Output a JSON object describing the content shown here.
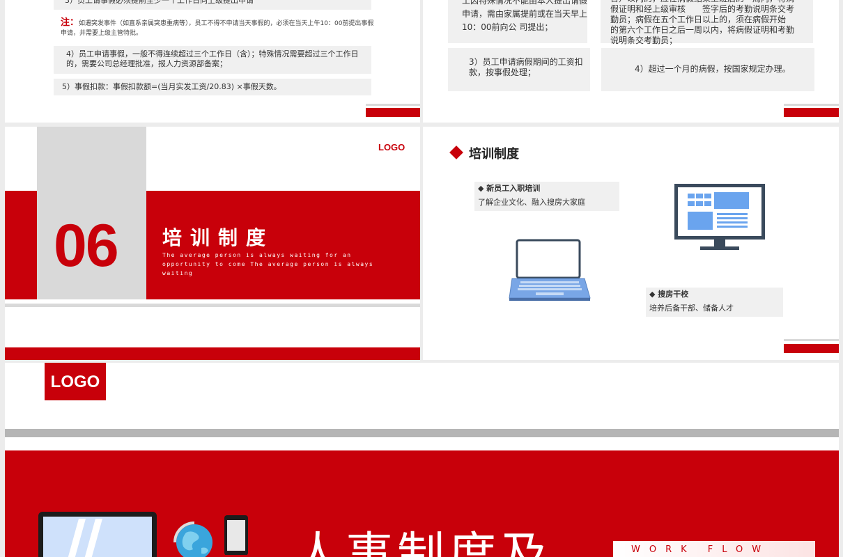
{
  "slide1": {
    "item3": "3）员工请事假必须提前至少一个工作日向上级提出申请",
    "note_label": "注：",
    "note_text": "如遇突发事件（如直系亲属突患重病等），员工不得不申请当天事假的，必须在当天上午10：00前提出事假申请，并需要上级主管特批。",
    "item4": "4）员工申请事假，一般不得连续超过三个工作日（含）；特殊情况需要超过三个工作日的，需要公司总经理批准，报人力资源部备案；",
    "item5": "5）事假扣款：事假扣款额=(当月实发工资/20.83) ×事假天数。"
  },
  "slide2": {
    "card1": "工因特殊情况不能由本人提出请假申请，需由家属提前或在当天早上10：00前向公 司提出；",
    "card2": "日）以内的，应在病假结束上班后的一周内，将病假证明和经上级审核　　签字后的考勤说明条交考勤员；病假在五个工作日以上的，须在病假开始　　的第六个工作日之后一周以内，将病假证明和考勤说明条交考勤员；",
    "card3": "3）员工申请病假期间的工资扣款，按事假处理；",
    "card4": "4）超过一个月的病假，按国家规定办理。"
  },
  "slide3": {
    "number": "06",
    "title": "培训制度",
    "subtitle": "The average person is always waiting for an opportunity to come The average person is always waiting",
    "logo": "LOGO"
  },
  "slide4": {
    "heading": "培训制度",
    "card1_title": "◆ 新员工入职培训",
    "card1_text": "了解企业文化、融入搜房大家庭",
    "card2_title": "◆ 搜房干校",
    "card2_text": "培养后备干部、储备人才",
    "icons": [
      "laptop-icon",
      "monitor-icon"
    ]
  },
  "slide5": {
    "logo": "LOGO",
    "title": "人事制度及",
    "workflow": "WORK FLOW",
    "icons": [
      "laptop-icon",
      "globe-icon",
      "phone-icon"
    ]
  },
  "colors": {
    "brand_red": "#c8000a",
    "grey": "#d9d9d9",
    "box_bg": "#f0f0f0"
  }
}
